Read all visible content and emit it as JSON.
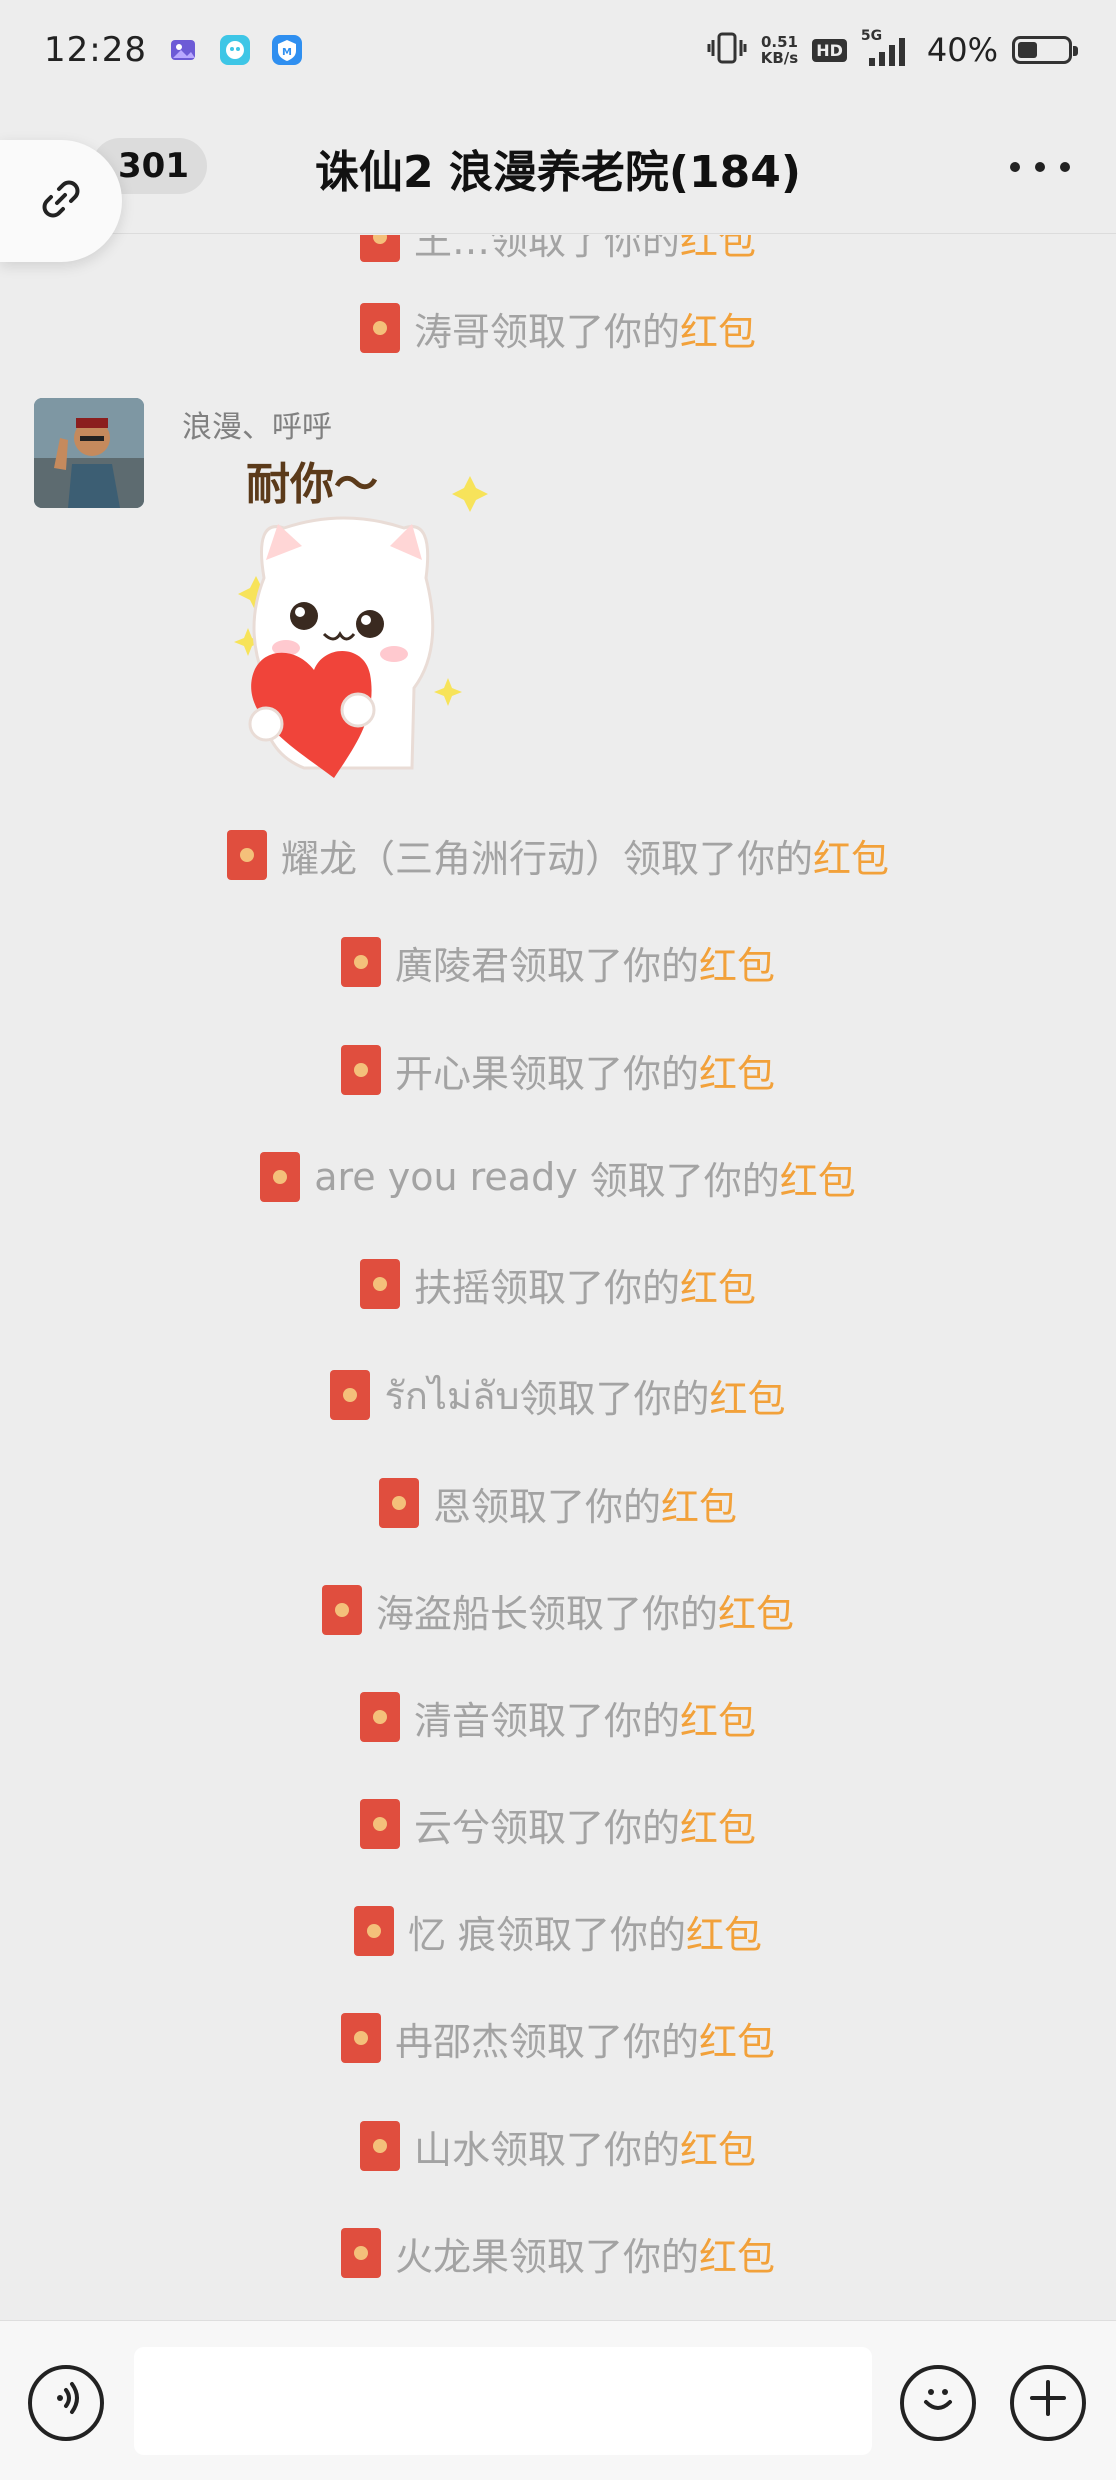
{
  "status_bar": {
    "time": "12:28",
    "net_speed_value": "0.51",
    "net_speed_unit": "KB/s",
    "hd_label": "HD",
    "network_label": "5G",
    "battery_text": "40%",
    "battery_level": 0.4
  },
  "header": {
    "unread_count": "301",
    "title": "诛仙2  浪漫养老院(184)"
  },
  "messages": {
    "top_partial": {
      "pre": "",
      "name": "王…领取了你的",
      "pkt": "红包"
    },
    "lines_before": [
      {
        "name": "涛哥",
        "mid": "领取了你的",
        "pkt": "红包"
      }
    ],
    "sticker_msg": {
      "sender": "浪漫、呼呼",
      "caption": "耐你～"
    },
    "lines_after": [
      {
        "name": "耀龙（三角洲行动）",
        "mid": "领取了你的",
        "pkt": "红包"
      },
      {
        "name": "廣陵君",
        "mid": "领取了你的",
        "pkt": "红包"
      },
      {
        "name": "开心果",
        "mid": "领取了你的",
        "pkt": "红包"
      },
      {
        "name": "are you ready ",
        "mid": "领取了你的",
        "pkt": "红包"
      },
      {
        "name": "扶摇",
        "mid": "领取了你的",
        "pkt": "红包"
      },
      {
        "name": "รักไม่ลับ",
        "mid": "领取了你的",
        "pkt": "红包"
      },
      {
        "name": "恩",
        "mid": "领取了你的",
        "pkt": "红包"
      },
      {
        "name": "海盗船长",
        "mid": "领取了你的",
        "pkt": "红包"
      },
      {
        "name": "清音",
        "mid": "领取了你的",
        "pkt": "红包"
      },
      {
        "name": "云兮",
        "mid": "领取了你的",
        "pkt": "红包"
      },
      {
        "name": "忆 痕",
        "mid": "领取了你的",
        "pkt": "红包"
      },
      {
        "name": "冉邵杰",
        "mid": "领取了你的",
        "pkt": "红包"
      },
      {
        "name": "山水",
        "mid": "领取了你的",
        "pkt": "红包"
      },
      {
        "name": "火龙果",
        "mid": "领取了你的",
        "pkt": "红包"
      }
    ]
  },
  "input_bar": {
    "placeholder": ""
  },
  "colors": {
    "background": "#ededed",
    "system_text": "#a3a3a3",
    "red_packet_word": "#f2a13a",
    "red_packet_icon": "#e04e3e"
  },
  "icons": {
    "link": "link-icon",
    "more": "more-icon",
    "voice": "voice-icon",
    "emoji": "emoji-icon",
    "plus": "plus-icon",
    "red_packet": "red-packet-icon"
  }
}
